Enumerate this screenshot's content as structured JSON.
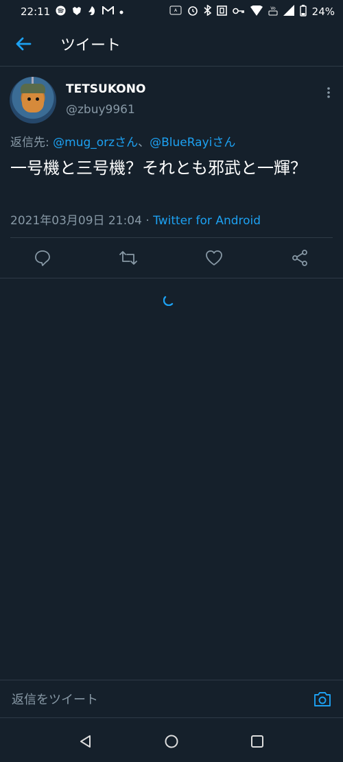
{
  "status_bar": {
    "time": "22:11",
    "battery": "24%",
    "left_icons": [
      "spotify-icon",
      "game-icon",
      "hand-icon",
      "mail-icon",
      "dot-icon"
    ],
    "right_icons": [
      "auto-icon",
      "alarm-icon",
      "bluetooth-icon",
      "nfc-icon",
      "key-icon",
      "wifi-icon",
      "volte-icon",
      "signal-icon",
      "battery-icon"
    ]
  },
  "header": {
    "title": "ツイート",
    "back_icon": "back-arrow-icon"
  },
  "tweet": {
    "display_name": "TETSUKONO",
    "handle": "@zbuy9961",
    "reply_prefix": "返信先: ",
    "mention1": "@mug_orzさん",
    "separator": "、",
    "mention2": "@BlueRayiさん",
    "text": "一号機と三号機？それとも邪武と一輝？",
    "timestamp": "2021年03月09日 21:04",
    "meta_sep": " · ",
    "source": "Twitter for Android"
  },
  "actions": [
    "reply-icon",
    "retweet-icon",
    "like-icon",
    "share-icon"
  ],
  "reply_bar": {
    "placeholder": "返信をツイート"
  },
  "colors": {
    "background": "#15202b",
    "accent": "#1da1f2",
    "muted": "#8899a6",
    "divider": "#2f3b47"
  }
}
